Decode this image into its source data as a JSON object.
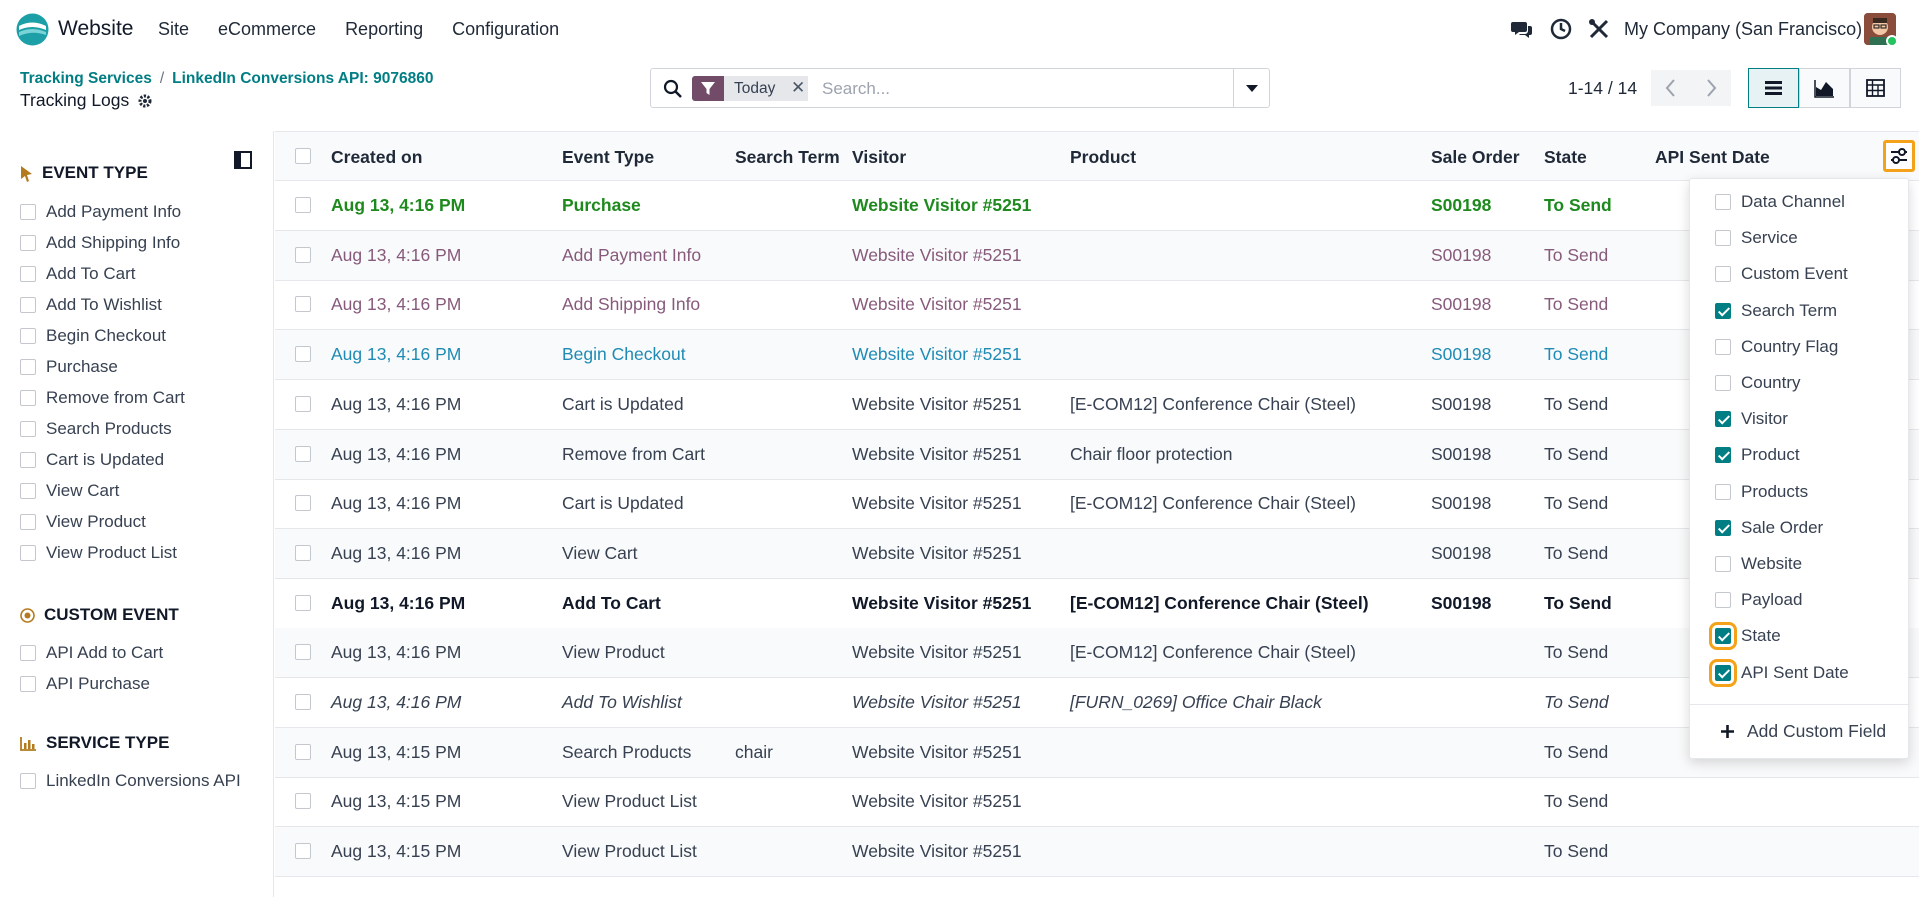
{
  "navbar": {
    "app_name": "Website",
    "menu": [
      "Site",
      "eCommerce",
      "Reporting",
      "Configuration"
    ],
    "company": "My Company (San Francisco)"
  },
  "control_panel": {
    "breadcrumb": [
      "Tracking Services",
      "LinkedIn Conversions API: 9076860"
    ],
    "title": "Tracking Logs",
    "search": {
      "facet": "Today",
      "placeholder": "Search..."
    },
    "pager": "1-14 / 14"
  },
  "sidebar": {
    "sections": [
      {
        "title": "EVENT TYPE",
        "icon": "cursor-icon",
        "items": [
          "Add Payment Info",
          "Add Shipping Info",
          "Add To Cart",
          "Add To Wishlist",
          "Begin Checkout",
          "Purchase",
          "Remove from Cart",
          "Search Products",
          "Cart is Updated",
          "View Cart",
          "View Product",
          "View Product List"
        ]
      },
      {
        "title": "CUSTOM EVENT",
        "icon": "target-icon",
        "items": [
          "API Add to Cart",
          "API Purchase"
        ]
      },
      {
        "title": "SERVICE TYPE",
        "icon": "bar-chart-icon",
        "items": [
          "LinkedIn Conversions API"
        ]
      }
    ]
  },
  "table": {
    "columns": [
      "Created on",
      "Event Type",
      "Search Term",
      "Visitor",
      "Product",
      "Sale Order",
      "State",
      "API Sent Date"
    ],
    "rows": [
      {
        "created": "Aug 13, 4:16 PM",
        "event": "Purchase",
        "search": "",
        "visitor": "Website Visitor #5251",
        "product": "",
        "order": "S00198",
        "state": "To Send",
        "style": "green"
      },
      {
        "created": "Aug 13, 4:16 PM",
        "event": "Add Payment Info",
        "search": "",
        "visitor": "Website Visitor #5251",
        "product": "",
        "order": "S00198",
        "state": "To Send",
        "style": "purple"
      },
      {
        "created": "Aug 13, 4:16 PM",
        "event": "Add Shipping Info",
        "search": "",
        "visitor": "Website Visitor #5251",
        "product": "",
        "order": "S00198",
        "state": "To Send",
        "style": "purple"
      },
      {
        "created": "Aug 13, 4:16 PM",
        "event": "Begin Checkout",
        "search": "",
        "visitor": "Website Visitor #5251",
        "product": "",
        "order": "S00198",
        "state": "To Send",
        "style": "blue"
      },
      {
        "created": "Aug 13, 4:16 PM",
        "event": "Cart is Updated",
        "search": "",
        "visitor": "Website Visitor #5251",
        "product": "[E-COM12] Conference Chair (Steel)",
        "order": "S00198",
        "state": "To Send",
        "style": "normal"
      },
      {
        "created": "Aug 13, 4:16 PM",
        "event": "Remove from Cart",
        "search": "",
        "visitor": "Website Visitor #5251",
        "product": "Chair floor protection",
        "order": "S00198",
        "state": "To Send",
        "style": "normal"
      },
      {
        "created": "Aug 13, 4:16 PM",
        "event": "Cart is Updated",
        "search": "",
        "visitor": "Website Visitor #5251",
        "product": "[E-COM12] Conference Chair (Steel)",
        "order": "S00198",
        "state": "To Send",
        "style": "normal"
      },
      {
        "created": "Aug 13, 4:16 PM",
        "event": "View Cart",
        "search": "",
        "visitor": "Website Visitor #5251",
        "product": "",
        "order": "S00198",
        "state": "To Send",
        "style": "normal"
      },
      {
        "created": "Aug 13, 4:16 PM",
        "event": "Add To Cart",
        "search": "",
        "visitor": "Website Visitor #5251",
        "product": "[E-COM12] Conference Chair (Steel)",
        "order": "S00198",
        "state": "To Send",
        "style": "bold"
      },
      {
        "created": "Aug 13, 4:16 PM",
        "event": "View Product",
        "search": "",
        "visitor": "Website Visitor #5251",
        "product": "[E-COM12] Conference Chair (Steel)",
        "order": "",
        "state": "To Send",
        "style": "normal"
      },
      {
        "created": "Aug 13, 4:16 PM",
        "event": "Add To Wishlist",
        "search": "",
        "visitor": "Website Visitor #5251",
        "product": "[FURN_0269] Office Chair Black",
        "order": "",
        "state": "To Send",
        "style": "italic"
      },
      {
        "created": "Aug 13, 4:15 PM",
        "event": "Search Products",
        "search": "chair",
        "visitor": "Website Visitor #5251",
        "product": "",
        "order": "",
        "state": "To Send",
        "style": "normal"
      },
      {
        "created": "Aug 13, 4:15 PM",
        "event": "View Product List",
        "search": "",
        "visitor": "Website Visitor #5251",
        "product": "",
        "order": "",
        "state": "To Send",
        "style": "normal"
      },
      {
        "created": "Aug 13, 4:15 PM",
        "event": "View Product List",
        "search": "",
        "visitor": "Website Visitor #5251",
        "product": "",
        "order": "",
        "state": "To Send",
        "style": "normal"
      }
    ]
  },
  "optional_columns": {
    "items": [
      {
        "label": "Data Channel",
        "checked": false
      },
      {
        "label": "Service",
        "checked": false
      },
      {
        "label": "Custom Event",
        "checked": false
      },
      {
        "label": "Search Term",
        "checked": true
      },
      {
        "label": "Country Flag",
        "checked": false
      },
      {
        "label": "Country",
        "checked": false
      },
      {
        "label": "Visitor",
        "checked": true
      },
      {
        "label": "Product",
        "checked": true
      },
      {
        "label": "Products",
        "checked": false
      },
      {
        "label": "Sale Order",
        "checked": true
      },
      {
        "label": "Website",
        "checked": false
      },
      {
        "label": "Payload",
        "checked": false
      },
      {
        "label": "State",
        "checked": true,
        "highlighted": true
      },
      {
        "label": "API Sent Date",
        "checked": true,
        "highlighted": true
      }
    ],
    "add_label": "Add Custom Field"
  },
  "colors": {
    "teal": "#017e84",
    "purple": "#714b67",
    "green": "#1e8a1e",
    "row_purple": "#875a7b",
    "row_blue": "#1f8bb5",
    "highlight": "#f4a21a"
  }
}
